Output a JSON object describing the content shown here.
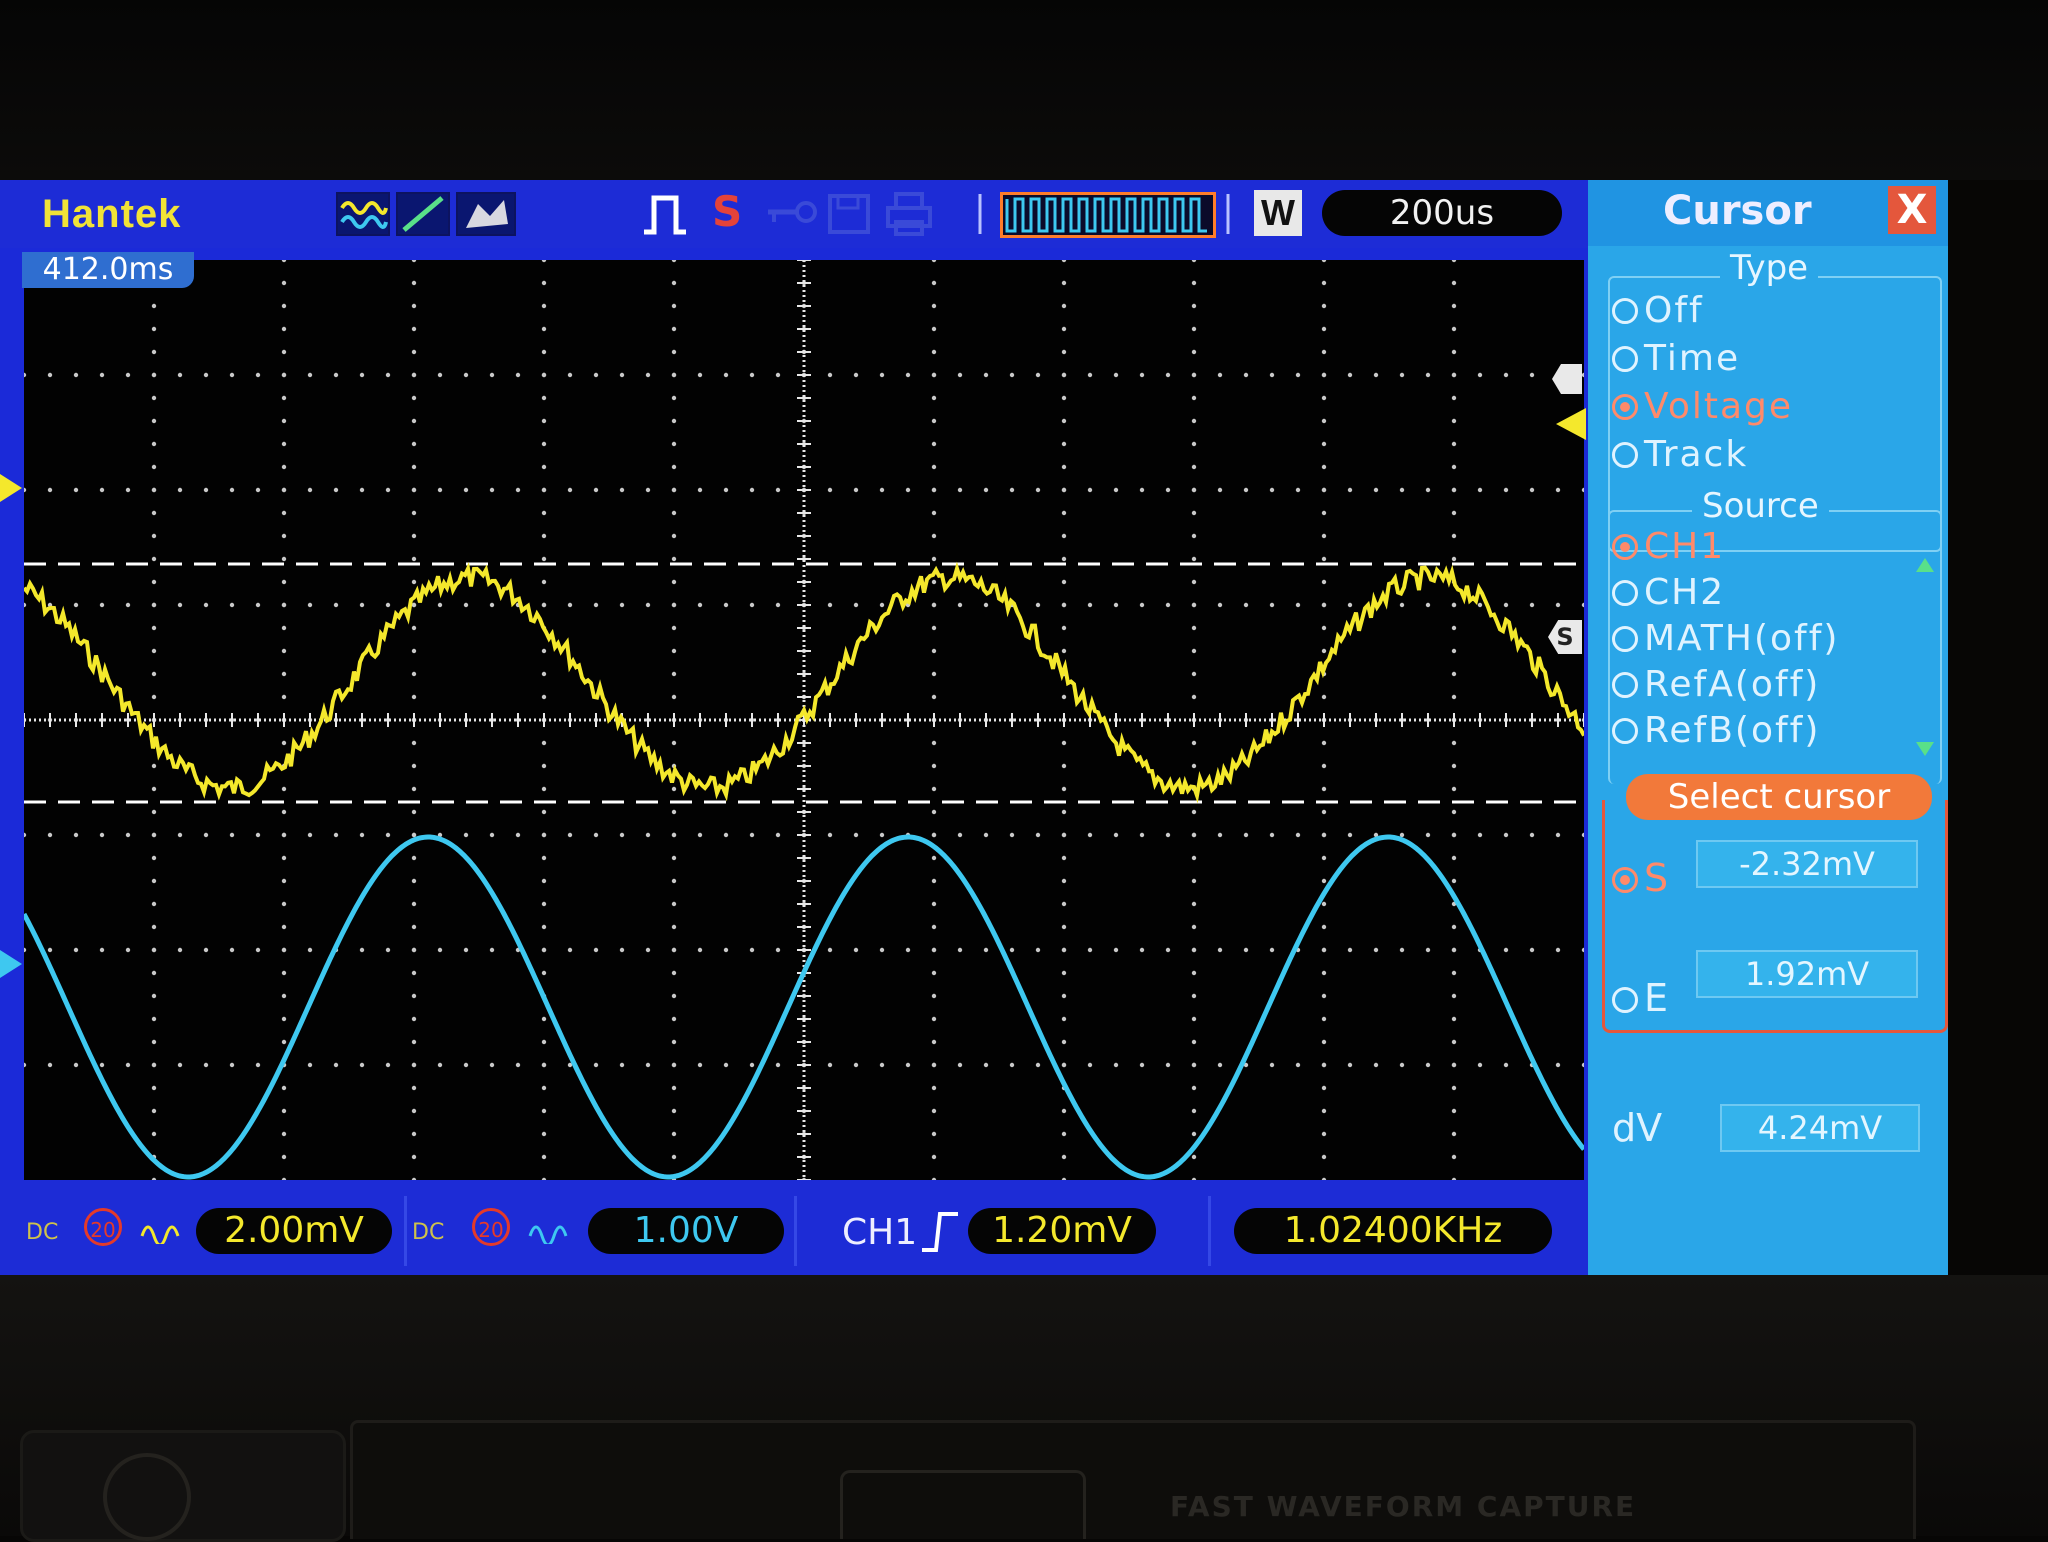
{
  "header": {
    "brand": "Hantek",
    "timebase": "200us",
    "waveform_mode": "W",
    "trigger_source_icon": "S",
    "icons": [
      "waveform-icon",
      "cursor-line-icon",
      "probe-icon",
      "pulse-icon",
      "trigger-s-icon",
      "key-icon",
      "save-icon",
      "print-icon",
      "run-stop-indicator"
    ]
  },
  "display": {
    "horizontal_position": "412.0ms",
    "ch1_color": "#f4e82c",
    "ch2_color": "#3ec8f0",
    "cursor_color": "#ffffff"
  },
  "status_bar": {
    "ch1_coupling": "DC",
    "ch1_bw": "20",
    "ch1_scale": "2.00mV",
    "ch2_coupling": "DC",
    "ch2_bw": "20",
    "ch2_scale": "1.00V",
    "trigger_source": "CH1",
    "trigger_level": "1.20mV",
    "frequency": "1.02400KHz"
  },
  "cursor_panel": {
    "title": "Cursor",
    "close_label": "X",
    "type_label": "Type",
    "type_options": [
      {
        "label": "Off",
        "selected": false
      },
      {
        "label": "Time",
        "selected": false
      },
      {
        "label": "Voltage",
        "selected": true
      },
      {
        "label": "Track",
        "selected": false
      }
    ],
    "source_label": "Source",
    "source_options": [
      {
        "label": "CH1",
        "selected": true
      },
      {
        "label": "CH2",
        "selected": false
      },
      {
        "label": "MATH(off)",
        "selected": false
      },
      {
        "label": "RefA(off)",
        "selected": false
      },
      {
        "label": "RefB(off)",
        "selected": false
      }
    ],
    "select_cursor_label": "Select cursor",
    "s_label": "S",
    "s_value": "-2.32mV",
    "e_label": "E",
    "e_value": "1.92mV",
    "dv_label": "dV",
    "dv_value": "4.24mV"
  },
  "device": {
    "silk_text": "FAST WAVEFORM CAPTURE"
  }
}
